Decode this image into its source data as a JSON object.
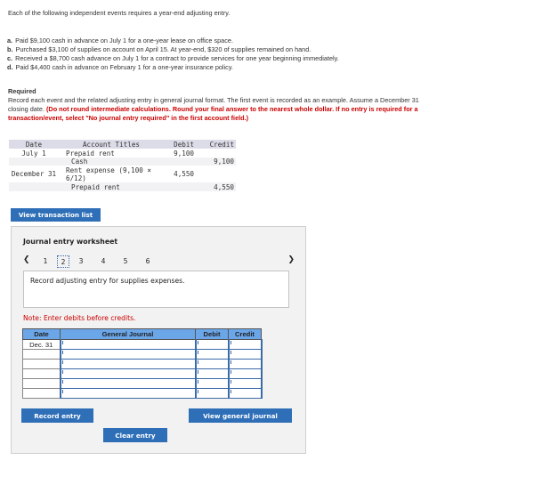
{
  "intro": "Each of the following independent events requires a year-end adjusting entry.",
  "events": [
    {
      "letter": "a.",
      "text": "Paid $9,100 cash in advance on July 1 for a one-year lease on office space."
    },
    {
      "letter": "b.",
      "text": "Purchased $3,100 of supplies on account on April 15. At year-end, $320 of supplies remained on hand."
    },
    {
      "letter": "c.",
      "text": "Received a $8,700 cash advance on July 1 for a contract to provide services for one year beginning immediately."
    },
    {
      "letter": "d.",
      "text": "Paid $4,400 cash in advance on February 1 for a one-year insurance policy."
    }
  ],
  "required": {
    "title": "Required",
    "body": "Record each event and the related adjusting entry in general journal format. The first event is recorded as an example. Assume a December 31 closing date. ",
    "instruction": "(Do not round intermediate calculations. Round your final answer to the nearest whole dollar. If no entry is required for a transaction/event, select \"No journal entry required\" in the first account field.)"
  },
  "example": {
    "headers": {
      "date": "Date",
      "account": "Account Titles",
      "debit": "Debit",
      "credit": "Credit"
    },
    "rows": [
      {
        "date": "July 1",
        "account": "Prepaid rent",
        "debit": "9,100",
        "credit": ""
      },
      {
        "date": "",
        "account": "Cash",
        "debit": "",
        "credit": "9,100"
      },
      {
        "date": "December 31",
        "account": "Rent expense (9,100 × 6/12)",
        "debit": "4,550",
        "credit": ""
      },
      {
        "date": "",
        "account": "Prepaid rent",
        "debit": "",
        "credit": "4,550"
      }
    ]
  },
  "buttons": {
    "view_transaction_list": "View transaction list",
    "record_entry": "Record entry",
    "view_general_journal": "View general journal",
    "clear_entry": "Clear entry"
  },
  "worksheet": {
    "title": "Journal entry worksheet",
    "prev_icon": "chevron-left-icon",
    "next_icon": "chevron-right-icon",
    "pages": [
      "1",
      "2",
      "3",
      "4",
      "5",
      "6"
    ],
    "active_page": "2",
    "description": "Record adjusting entry for supplies expenses.",
    "note": "Note: Enter debits before credits.",
    "table": {
      "headers": {
        "date": "Date",
        "journal": "General Journal",
        "debit": "Debit",
        "credit": "Credit"
      },
      "rows": [
        {
          "date": "Dec. 31",
          "account": "",
          "debit": "",
          "credit": ""
        },
        {
          "date": "",
          "account": "",
          "debit": "",
          "credit": ""
        },
        {
          "date": "",
          "account": "",
          "debit": "",
          "credit": ""
        },
        {
          "date": "",
          "account": "",
          "debit": "",
          "credit": ""
        },
        {
          "date": "",
          "account": "",
          "debit": "",
          "credit": ""
        },
        {
          "date": "",
          "account": "",
          "debit": "",
          "credit": ""
        }
      ]
    }
  }
}
